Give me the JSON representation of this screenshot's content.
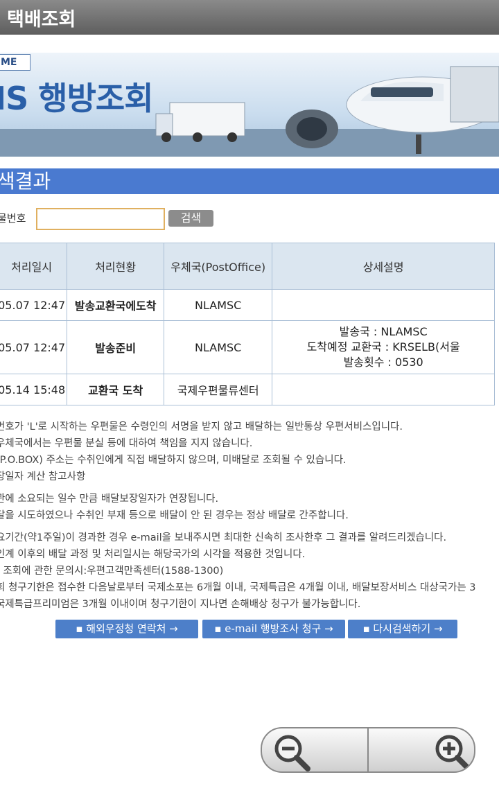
{
  "appbar": {
    "title": "택배조회"
  },
  "banner": {
    "tag": "ME",
    "title": "IS 행방조회"
  },
  "section": {
    "title": "색결과"
  },
  "search": {
    "label": "물번호",
    "value": "",
    "button_label": "검색"
  },
  "table": {
    "headers": [
      "처리일시",
      "처리현황",
      "우체국(PostOffice)",
      "상세설명"
    ],
    "rows": [
      {
        "datetime": "05.07 12:47",
        "status": "발송교환국에도착",
        "office": "NLAMSC",
        "detail": [
          "",
          "",
          ""
        ]
      },
      {
        "datetime": "05.07 12:47",
        "status": "발송준비",
        "office": "NLAMSC",
        "detail": [
          "발송국 : NLAMSC",
          "도착예정 교환국 : KRSELB(서울",
          "발송횟수 : 0530"
        ]
      },
      {
        "datetime": "05.14 15:48",
        "status": "교환국 도착",
        "office": "국제우편물류센터",
        "detail": [
          "",
          "",
          ""
        ]
      }
    ]
  },
  "notes": [
    "번호가 'L'로 시작하는 우편물은 수령인의 서명을 받지 않고 배달하는 일반통상 우편서비스입니다.",
    " 우체국에서는 우편물 분실 등에 대하여 책임을 지지 않습니다.",
    "(P.O.BOX) 주소는 수취인에게 직접 배달하지 않으며, 미배달로 조회될 수 있습니다.",
    "장일자 계산 참고사항",
    "관에 소요되는 일수 만큼 배달보장일자가 연장됩니다.",
    "달을 시도하였으나 수취인 부재 등으로 배달이 안 된 경우는 정상 배달로 간주합니다.",
    "요기간(약1주일)이 경과한 경우 e-mail을 보내주시면 최대한 신속히 조사한후 그 결과를 알려드리겠습니다.",
    " 인계 이후의 배달 과정 및 처리일시는 해당국가의 시각을 적용한 것입니다.",
    "! 조회에 관한 문의시:우편고객만족센터(1588-1300)",
    "회 청구기한은 접수한 다음날로부터 국제소포는 6개월 이내, 국제특급은 4개월 이내, 배달보장서비스 대상국가는 3",
    "국제특급프리미엄은 3개월 이내이며 청구기한이 지나면 손해배상 청구가 불가능합니다."
  ],
  "actions": {
    "overseas_contact": "▪ 해외우정청 연락처 →",
    "email_request": "▪ e-mail 행방조사 청구 →",
    "research": "▪ 다시검색하기 →"
  },
  "zoom": {
    "out_icon": "zoom-out-icon",
    "in_icon": "zoom-in-icon"
  }
}
